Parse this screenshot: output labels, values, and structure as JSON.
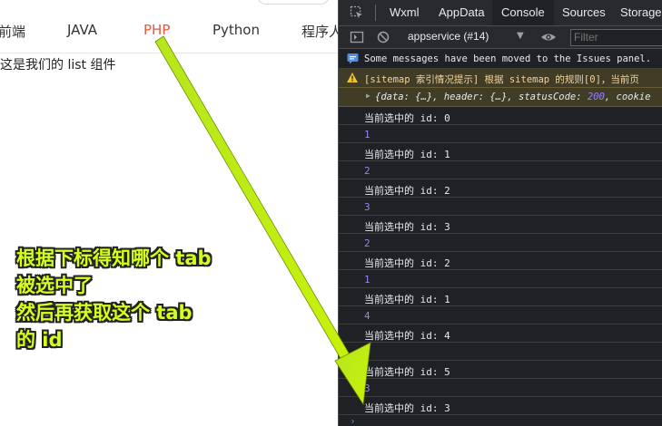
{
  "simulator": {
    "tabs": [
      {
        "label": "前端",
        "active": false
      },
      {
        "label": "JAVA",
        "active": false
      },
      {
        "label": "PHP",
        "active": true
      },
      {
        "label": "Python",
        "active": false
      },
      {
        "label": "程序人",
        "active": false
      }
    ],
    "active_tab_color": "#e4573d",
    "list_text": "这是我们的 list 组件"
  },
  "devtools": {
    "tabs": [
      {
        "label": "Wxml",
        "active": false
      },
      {
        "label": "AppData",
        "active": false
      },
      {
        "label": "Console",
        "active": true
      },
      {
        "label": "Sources",
        "active": false
      },
      {
        "label": "Storage",
        "active": false
      }
    ],
    "toolbar": {
      "context": "appservice (#14)",
      "filter_placeholder": "Filter"
    },
    "console": {
      "info_message": "Some messages have been moved to the Issues panel.",
      "warning_message": "[sitemap 索引情况提示] 根据 sitemap 的规则[0]，当前页",
      "object_preview": {
        "prefix": "{data: {…}, header: {…}, statusCode: ",
        "status_code": "200",
        "suffix": ", cookie"
      },
      "log_prefix": "当前选中的 id: ",
      "entries": [
        {
          "id": "0",
          "value": "1"
        },
        {
          "id": "1",
          "value": "2"
        },
        {
          "id": "2",
          "value": "3"
        },
        {
          "id": "3",
          "value": "2"
        },
        {
          "id": "2",
          "value": "1"
        },
        {
          "id": "1",
          "value": "4"
        },
        {
          "id": "4",
          "value": "5"
        },
        {
          "id": "5",
          "value": "3"
        },
        {
          "id": "3",
          "value": ""
        }
      ]
    }
  },
  "annotation": {
    "lines": [
      "根据下标得知哪个 tab",
      "被选中了",
      "然后再获取这个 tab",
      "的 id"
    ],
    "color": "#c8f20a"
  }
}
